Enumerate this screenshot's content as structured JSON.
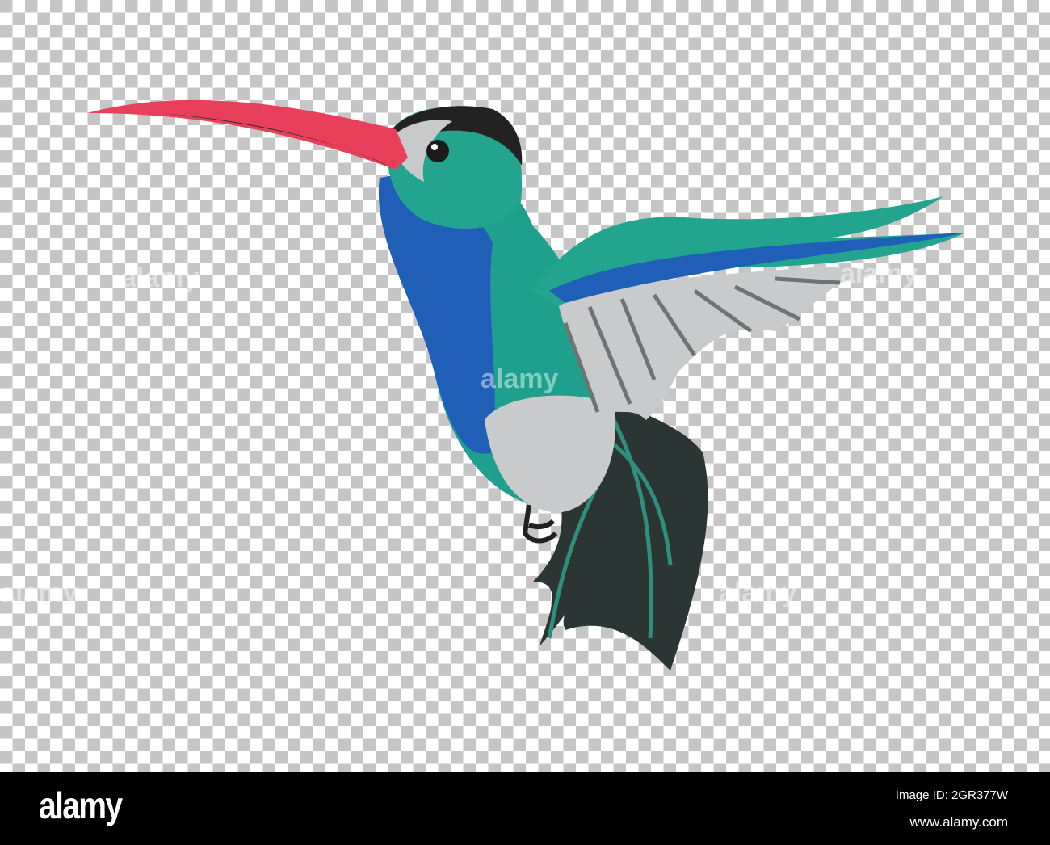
{
  "image": {
    "subject": "hummingbird-illustration",
    "watermark": "alamy"
  },
  "footer": {
    "logo": "alamy",
    "image_id": "Image ID: 2GR377W",
    "website": "www.alamy.com"
  },
  "colors": {
    "beak": "#e8405a",
    "teal": "#1fa08f",
    "blue": "#1f5fb8",
    "grey": "#c9cacc",
    "dark": "#2a3432"
  }
}
